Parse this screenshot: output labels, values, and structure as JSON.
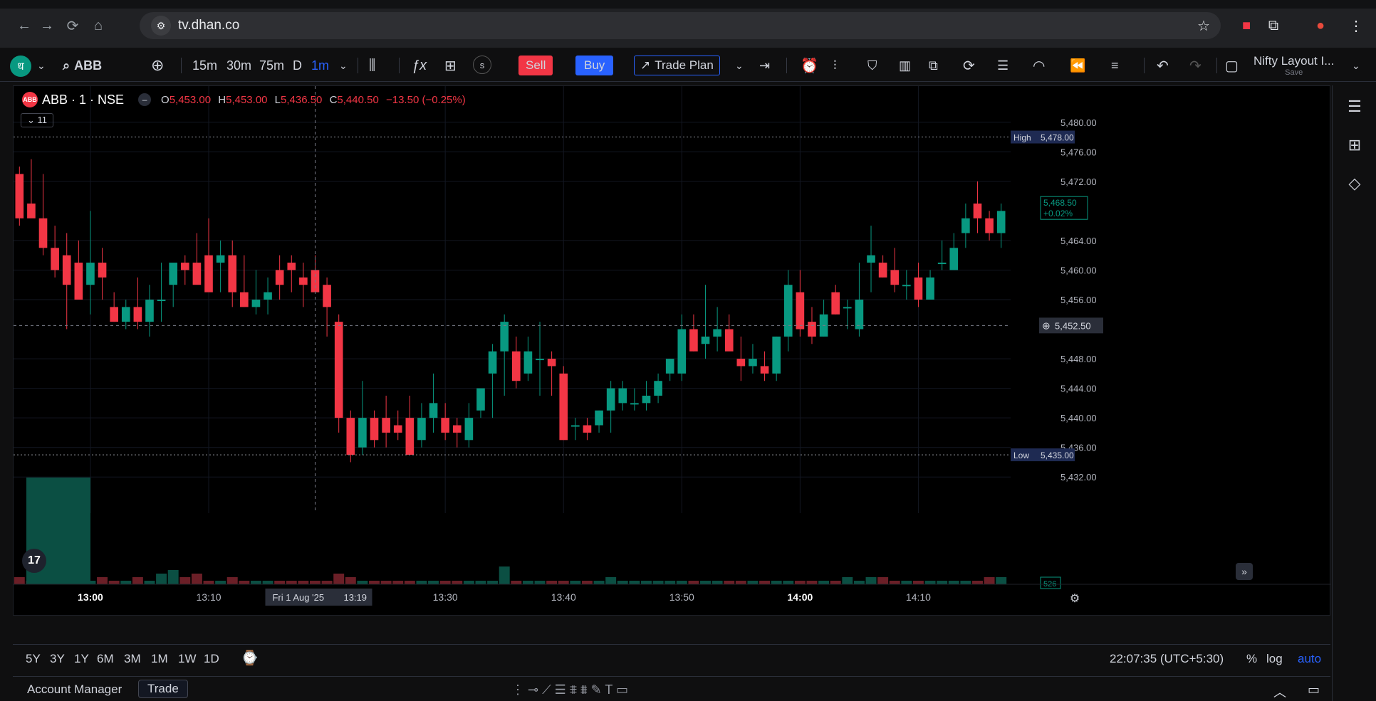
{
  "browser": {
    "url": "tv.dhan.co"
  },
  "toolbar": {
    "symbol_search": "ABB",
    "intervals": [
      "15m",
      "30m",
      "75m",
      "D",
      "1m"
    ],
    "active_interval": "1m",
    "sell_label": "Sell",
    "buy_label": "Buy",
    "trade_plan_label": "Trade Plan",
    "layout_name": "Nifty Layout I...",
    "layout_save": "Save"
  },
  "legend": {
    "symbol": "ABB · 1 · NSE",
    "logo": "ABB",
    "o_label": "O",
    "o_val": "5,453.00",
    "h_label": "H",
    "h_val": "5,453.00",
    "l_label": "L",
    "l_val": "5,436.50",
    "c_label": "C",
    "c_val": "5,440.50",
    "change": "−13.50 (−0.25%)",
    "indicator_count": "11"
  },
  "colors": {
    "up": "#089981",
    "down": "#f23645",
    "accent": "#2962ff"
  },
  "chart_data": {
    "type": "candlestick",
    "ylim": [
      5430,
      5482
    ],
    "y_ticks": [
      "5,480.00",
      "5,476.00",
      "5,472.00",
      "5,464.00",
      "5,460.00",
      "5,456.00",
      "5,448.00",
      "5,444.00",
      "5,440.00",
      "5,436.00",
      "5,432.00"
    ],
    "x_ticks": [
      {
        "label": "13:00",
        "i": 6,
        "bold": true
      },
      {
        "label": "13:10",
        "i": 16
      },
      {
        "label": "13:30",
        "i": 36
      },
      {
        "label": "13:40",
        "i": 46
      },
      {
        "label": "13:50",
        "i": 56
      },
      {
        "label": "14:00",
        "i": 66,
        "bold": true
      },
      {
        "label": "14:10",
        "i": 76
      }
    ],
    "crosshair": {
      "i": 25,
      "date_label": "Fri 1 Aug '25",
      "time_label": "13:19",
      "price_label": "5,452.50",
      "price": 5452.5
    },
    "high_line": {
      "label": "High",
      "price": 5478.0,
      "value": "5,478.00"
    },
    "low_line": {
      "label": "Low",
      "price": 5435.0,
      "value": "5,435.00"
    },
    "last_price": {
      "price": 5468.5,
      "value": "5,468.50",
      "change": "+0.02%"
    },
    "volume_label": "526",
    "candles": [
      [
        5473,
        5474,
        5466,
        5467
      ],
      [
        5469,
        5475,
        5467.5,
        5467
      ],
      [
        5467,
        5473,
        5462,
        5463
      ],
      [
        5463,
        5466,
        5459,
        5460
      ],
      [
        5462,
        5465,
        5452,
        5458
      ],
      [
        5461,
        5464,
        5457,
        5456
      ],
      [
        5458,
        5468,
        5454,
        5461
      ],
      [
        5461,
        5463,
        5456,
        5459
      ],
      [
        5455,
        5457,
        5453,
        5453
      ],
      [
        5453,
        5456,
        5452,
        5455
      ],
      [
        5455,
        5459,
        5452,
        5453
      ],
      [
        5453,
        5458,
        5451,
        5456
      ],
      [
        5456,
        5461,
        5453,
        5456
      ],
      [
        5458,
        5460,
        5455,
        5461
      ],
      [
        5461,
        5462,
        5458,
        5460
      ],
      [
        5461,
        5465,
        5459,
        5458
      ],
      [
        5462,
        5467,
        5458,
        5457
      ],
      [
        5461,
        5464,
        5457,
        5462
      ],
      [
        5462,
        5464,
        5455,
        5457
      ],
      [
        5457,
        5462,
        5455,
        5455
      ],
      [
        5455,
        5460,
        5454,
        5456
      ],
      [
        5456,
        5459,
        5454,
        5457
      ],
      [
        5460,
        5462,
        5456,
        5458
      ],
      [
        5461,
        5462,
        5457,
        5460
      ],
      [
        5459,
        5461,
        5455,
        5458
      ],
      [
        5460,
        5462,
        5458,
        5457
      ],
      [
        5458,
        5459,
        5451,
        5455
      ],
      [
        5453,
        5454,
        5438,
        5440
      ],
      [
        5440,
        5441,
        5434,
        5435
      ],
      [
        5436,
        5445,
        5435,
        5440
      ],
      [
        5440,
        5441,
        5436,
        5437
      ],
      [
        5440,
        5443,
        5436,
        5438
      ],
      [
        5439,
        5441,
        5437,
        5438
      ],
      [
        5440,
        5443,
        5436,
        5435
      ],
      [
        5437,
        5442,
        5436,
        5440
      ],
      [
        5440,
        5446,
        5438,
        5442
      ],
      [
        5440,
        5442,
        5437,
        5438
      ],
      [
        5439,
        5440,
        5436,
        5438
      ],
      [
        5437,
        5442,
        5436,
        5440
      ],
      [
        5441,
        5443,
        5440,
        5444
      ],
      [
        5446,
        5450,
        5440,
        5449
      ],
      [
        5449,
        5454,
        5443,
        5453
      ],
      [
        5449,
        5451,
        5444,
        5445
      ],
      [
        5446,
        5451,
        5445,
        5449
      ],
      [
        5448,
        5453,
        5443,
        5448
      ],
      [
        5448,
        5449,
        5443,
        5447
      ],
      [
        5446,
        5447,
        5437,
        5437
      ],
      [
        5439,
        5440,
        5437,
        5439
      ],
      [
        5439,
        5440,
        5437,
        5438
      ],
      [
        5439,
        5441,
        5438,
        5441
      ],
      [
        5441,
        5445,
        5438,
        5444
      ],
      [
        5442,
        5445,
        5441,
        5444
      ],
      [
        5442,
        5444,
        5441,
        5442
      ],
      [
        5442,
        5445,
        5441,
        5443
      ],
      [
        5443,
        5446,
        5442,
        5445
      ],
      [
        5446,
        5448,
        5445,
        5448
      ],
      [
        5446,
        5454,
        5445,
        5452
      ],
      [
        5452,
        5454,
        5449,
        5449
      ],
      [
        5450,
        5458,
        5448,
        5451
      ],
      [
        5451,
        5455,
        5449,
        5452
      ],
      [
        5452,
        5454,
        5450,
        5449
      ],
      [
        5448,
        5451,
        5445,
        5447
      ],
      [
        5447,
        5450,
        5446,
        5448
      ],
      [
        5447,
        5449,
        5445,
        5446
      ],
      [
        5446,
        5451,
        5445,
        5451
      ],
      [
        5451,
        5460,
        5449,
        5458
      ],
      [
        5457,
        5460,
        5451,
        5452
      ],
      [
        5453,
        5455,
        5450,
        5451
      ],
      [
        5451,
        5456,
        5451,
        5454
      ],
      [
        5457,
        5458,
        5454,
        5454
      ],
      [
        5455,
        5456,
        5452,
        5455
      ],
      [
        5452,
        5461,
        5451,
        5456
      ],
      [
        5461,
        5466,
        5457,
        5462
      ],
      [
        5461,
        5462,
        5459,
        5459
      ],
      [
        5460,
        5463,
        5457,
        5458
      ],
      [
        5458,
        5460,
        5456,
        5458
      ],
      [
        5459,
        5461,
        5455,
        5456
      ],
      [
        5456,
        5460,
        5456,
        5459
      ],
      [
        5461,
        5464,
        5460,
        5461
      ],
      [
        5460,
        5465,
        5460,
        5463
      ],
      [
        5465,
        5469,
        5463,
        5467
      ],
      [
        5469,
        5472,
        5465,
        5467
      ],
      [
        5467,
        5468,
        5464,
        5465
      ],
      [
        5465,
        5469,
        5463,
        5468
      ]
    ],
    "volumes": [
      2,
      1,
      6,
      3,
      1,
      2,
      1,
      2,
      1,
      1,
      2,
      1,
      3,
      4,
      2,
      3,
      1,
      1,
      2,
      1,
      1,
      1,
      1,
      1,
      1,
      1,
      1,
      3,
      2,
      1,
      1,
      1,
      1,
      1,
      1,
      1,
      1,
      1,
      1,
      1,
      1,
      5,
      1,
      1,
      1,
      1,
      1,
      1,
      1,
      1,
      2,
      1,
      1,
      1,
      1,
      1,
      1,
      1,
      1,
      1,
      1,
      1,
      1,
      1,
      1,
      1,
      1,
      1,
      1,
      1,
      2,
      1,
      2,
      2,
      1,
      1,
      1,
      1,
      1,
      1,
      1,
      1,
      2,
      2
    ]
  },
  "bottom": {
    "ranges": [
      "5Y",
      "3Y",
      "1Y",
      "6M",
      "3M",
      "1M",
      "1W",
      "1D"
    ],
    "clock": "22:07:35 (UTC+5:30)",
    "pct": "%",
    "log": "log",
    "auto": "auto"
  },
  "panel": {
    "account_manager": "Account Manager",
    "trade": "Trade"
  }
}
